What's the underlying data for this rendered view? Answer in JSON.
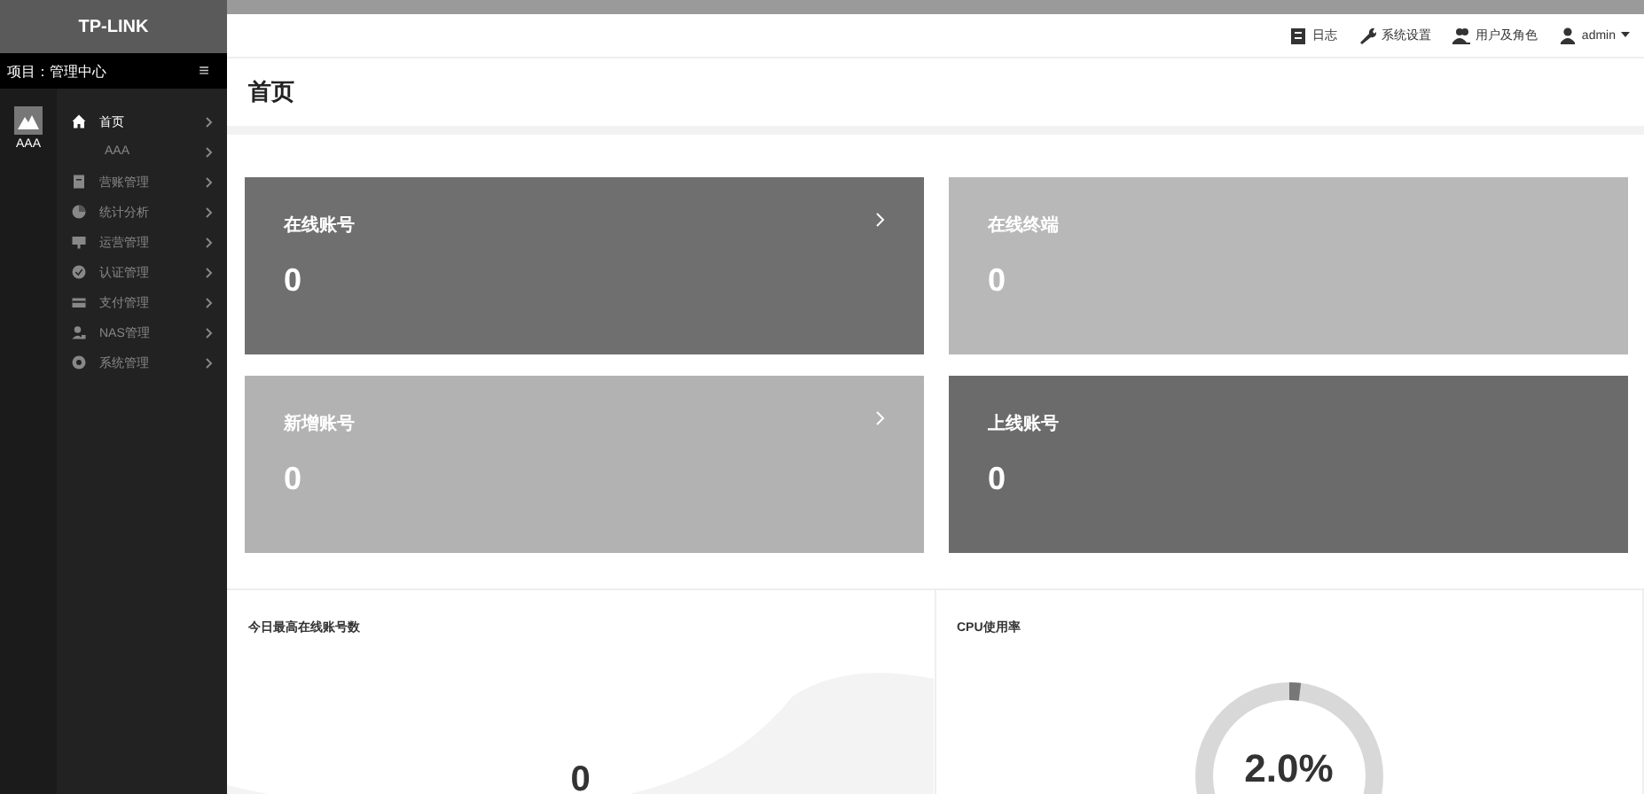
{
  "sidebar": {
    "logo": "TP-LINK",
    "project_label": "项目：",
    "project": "管理中心",
    "menu_toggle": "≡",
    "rail": [
      {
        "label": "AAA",
        "selected": true
      }
    ],
    "items": [
      {
        "label": "首页",
        "kind": "menu",
        "selected": true
      },
      {
        "label": "AAA",
        "kind": "submenu",
        "selected": false
      },
      {
        "label": "营账管理",
        "kind": "menu",
        "selected": false
      },
      {
        "label": "统计分析",
        "kind": "menu",
        "selected": false
      },
      {
        "label": "运营管理",
        "kind": "menu",
        "selected": false
      },
      {
        "label": "认证管理",
        "kind": "menu",
        "selected": false
      },
      {
        "label": "支付管理",
        "kind": "menu",
        "selected": false
      },
      {
        "label": "NAS管理",
        "kind": "menu",
        "selected": false
      },
      {
        "label": "系统管理",
        "kind": "menu",
        "selected": false
      }
    ]
  },
  "topbar": {
    "links": [
      {
        "label": "日志"
      },
      {
        "label": "系统设置"
      },
      {
        "label": "用户及角色"
      },
      {
        "label": "admin",
        "dropdown": true
      }
    ]
  },
  "page_title": "首页",
  "cards": [
    {
      "title": "在线账号",
      "value": "0",
      "link": true,
      "color": "#6f6f6f"
    },
    {
      "title": "在线终端",
      "value": "0",
      "link": false,
      "color": "#b8b8b8"
    },
    {
      "title": "新增账号",
      "value": "0",
      "link": true,
      "color": "#b2b2b2"
    },
    {
      "title": "上线账号",
      "value": "0",
      "link": false,
      "color": "#6b6b6b"
    }
  ],
  "panels": [
    {
      "title": "今日最高在线账号数",
      "kind": "wave",
      "value": "0"
    },
    {
      "title": "CPU使用率",
      "kind": "gauge",
      "value": "2.0%",
      "level": 0.02
    }
  ]
}
